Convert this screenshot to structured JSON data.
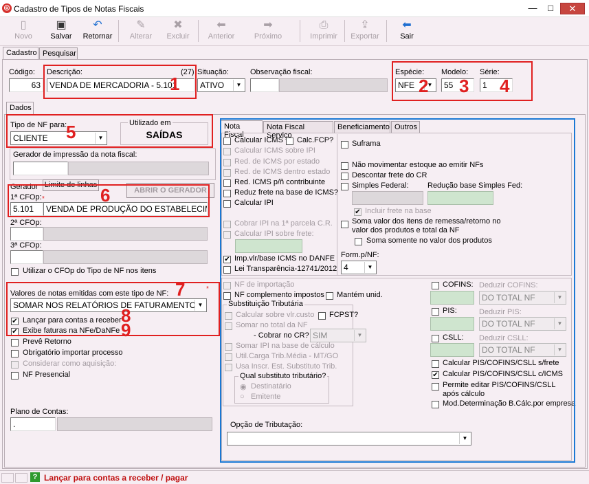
{
  "window": {
    "title": "Cadastro de Tipos de Notas Fiscais",
    "minimize": "—",
    "maximize": "□",
    "close": "✕"
  },
  "toolbar": {
    "novo": "Novo",
    "salvar": "Salvar",
    "retornar": "Retornar",
    "alterar": "Alterar",
    "excluir": "Excluir",
    "anterior": "Anterior",
    "proximo": "Próximo",
    "imprimir": "Imprimir",
    "exportar": "Exportar",
    "sair": "Sair"
  },
  "tabs": {
    "cadastro": "Cadastro",
    "pesquisar": "Pesquisar",
    "dados": "Dados"
  },
  "header": {
    "codigo_label": "Código:",
    "codigo_value": "63",
    "descricao_label": "Descrição:",
    "descricao_count": "(27)",
    "descricao_value": "VENDA DE MERCADORIA - 5.101",
    "situacao_label": "Situação:",
    "situacao_value": "ATIVO",
    "obs_label": "Observação fiscal:",
    "especie_label": "Espécie:",
    "especie_value": "NFE",
    "modelo_label": "Modelo:",
    "modelo_value": "55",
    "serie_label": "Série:",
    "serie_value": "1"
  },
  "left": {
    "tipo_nf_label": "Tipo de NF para:",
    "tipo_nf_value": "CLIENTE",
    "utilizado_label": "Utilizado em",
    "utilizado_value": "SAÍDAS",
    "gerador_label": "Gerador de impressão da nota fiscal:",
    "gerador_short": "Gerador",
    "limite_btn": "Limite de linhas",
    "abrir_btn": "ABRIR O GERADOR",
    "cfop1_label": "1ª CFOp:",
    "cfop1_code": "5.101",
    "cfop1_desc": "VENDA DE PRODUÇÃO DO ESTABELECIMENT",
    "cfop2_label": "2ª CFOp:",
    "cfop3_label": "3ª CFOp:",
    "utilizar_cfop": "Utilizar o CFOp do Tipo de NF nos itens",
    "valores_label": "Valores de notas emitidas com este tipo de NF:",
    "valores_value": "SOMAR NOS RELATÓRIOS DE FATURAMENTO",
    "lancar": "Lançar para contas a receber",
    "exibe": "Exibe faturas na NFe/DaNFe",
    "preve": "Prevê Retorno",
    "obrigatorio": "Obrigatório importar processo",
    "considerar": "Considerar como aquisição:",
    "presencial": "NF Presencial",
    "plano_label": "Plano de Contas:",
    "plano_value": "."
  },
  "nf_tabs": {
    "nota_fiscal": "Nota Fiscal",
    "nota_servico": "Nota Fiscal Serviço",
    "beneficiamento": "Beneficiamento",
    "outros": "Outros"
  },
  "nf": {
    "calc_icms": "Calcular ICMS",
    "calc_fcp": "Calc.FCP?",
    "calc_icms_ipi": "Calcular ICMS sobre IPI",
    "red_icms_estado": "Red. de ICMS por estado",
    "red_icms_dentro": "Red. de ICMS dentro estado",
    "red_icms_contrib": "Red. ICMS p/ñ contribuinte",
    "reduz_frete": "Reduz frete na base de ICMS?",
    "calc_ipi": "Calcular IPI",
    "cobrar_ipi": "Cobrar IPI na 1ª parcela C.R.",
    "calc_ipi_frete": "Calcular IPI sobre frete:",
    "imp_vlr": "Imp.vlr/base ICMS no DANFE",
    "lei_transp": "Lei Transparência-12741/2012",
    "suframa": "Suframa",
    "nao_mov": "Não movimentar estoque ao emitir NFs",
    "descontar": "Descontar frete do CR",
    "simples": "Simples Federal:",
    "reducao_simples": "Redução base Simples Fed:",
    "incluir_frete": "Incluir frete na base",
    "soma_valor": "Soma valor dos itens de remessa/retorno no valor dos produtos e total da NF",
    "soma_somente": "Soma somente no valor dos produtos",
    "form_label": "Form.p/NF:",
    "form_value": "4",
    "nf_importacao": "NF de importação",
    "nf_complemento": "NF complemento impostos",
    "mantem": "Mantém unid.",
    "subst_label": "Substituição Tributária",
    "calc_sobre_vlr": "Calcular sobre vlr.custo",
    "fcpst": "FCPST?",
    "somar_total": "Somar no total da NF",
    "cobrar_cr": "- Cobrar no CR?",
    "cobrar_value": "SIM",
    "somar_ipi": "Somar IPI na base de cálculo",
    "util_carga": "Util.Carga Trib.Média - MT/GO",
    "usa_inscr": "Usa Inscr. Est. Substituto Trib.",
    "qual_subst": "Qual substituto tributário?",
    "destinatario": "Destinatário",
    "emitente": "Emitente",
    "opcao_label": "Opção de Tributação:",
    "cofins": "COFINS:",
    "deduzir_cofins": "Deduzir COFINS:",
    "pis": "PIS:",
    "deduzir_pis": "Deduzir PIS:",
    "csll": "CSLL:",
    "deduzir_csll": "Deduzir CSLL:",
    "do_total": "DO TOTAL NF",
    "calc_pis_frete": "Calcular PIS/COFINS/CSLL s/frete",
    "calc_pis_icms": "Calcular PIS/COFINS/CSLL c/ICMS",
    "permite_editar": "Permite editar PIS/COFINS/CSLL após cálculo",
    "mod_det": "Mod.Determinação B.Cálc.por empresa"
  },
  "annotations": [
    "1",
    "2",
    "3",
    "4",
    "5",
    "6",
    "7",
    "8",
    "9"
  ],
  "status": {
    "text": "Lançar para contas a receber / pagar",
    "icon": "?"
  }
}
